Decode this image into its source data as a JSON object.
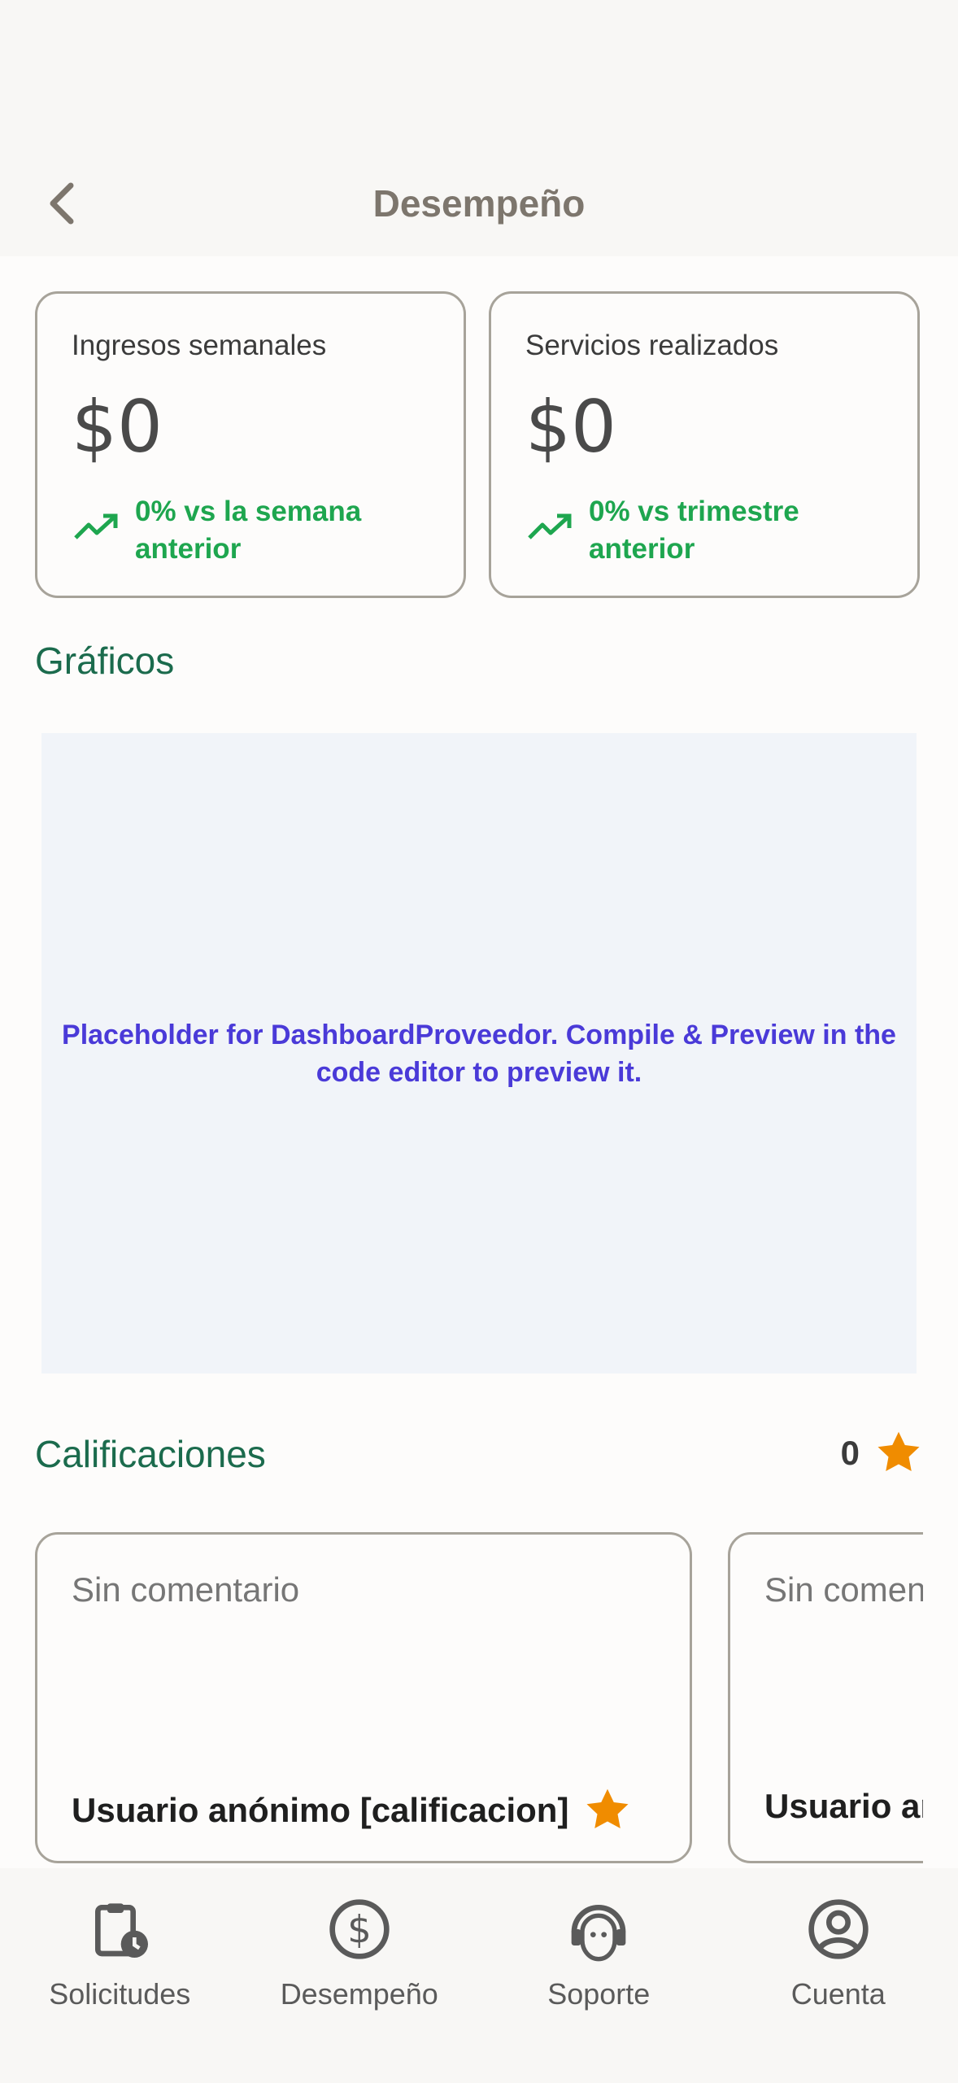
{
  "header": {
    "title": "Desempeño"
  },
  "cards": [
    {
      "label": "Ingresos semanales",
      "value": "$0",
      "trend": "0% vs la semana anterior"
    },
    {
      "label": "Servicios realizados",
      "value": "$0",
      "trend": "0% vs trimestre anterior"
    }
  ],
  "graphs": {
    "title": "Gráficos",
    "placeholder": "Placeholder for DashboardProveedor. Compile & Preview in the code editor to preview it."
  },
  "ratings": {
    "title": "Calificaciones",
    "count": "0",
    "reviews": [
      {
        "comment": "Sin comentario",
        "user": "Usuario anónimo [calificacion]"
      },
      {
        "comment": "Sin comentario",
        "user": "Usuario anónimo [calificacion]"
      }
    ]
  },
  "nav": [
    {
      "label": "Solicitudes",
      "icon": "clipboard-clock-icon"
    },
    {
      "label": "Desempeño",
      "icon": "dollar-circle-icon"
    },
    {
      "label": "Soporte",
      "icon": "support-agent-icon"
    },
    {
      "label": "Cuenta",
      "icon": "account-circle-icon"
    }
  ],
  "colors": {
    "accent_green": "#1ea64f",
    "section_title": "#1b6b4d",
    "star": "#f08c00",
    "placeholder_text": "#4a3ad8"
  }
}
